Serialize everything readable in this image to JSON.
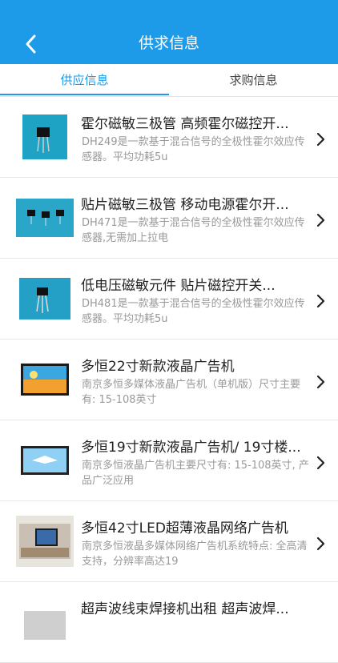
{
  "header": {
    "title": "供求信息",
    "back_icon": "back-arrow-icon"
  },
  "tabs": [
    {
      "label": "供应信息",
      "active": true
    },
    {
      "label": "求购信息",
      "active": false
    }
  ],
  "colors": {
    "primary": "#1e9be8",
    "title_text": "#222222",
    "desc_text": "#999999"
  },
  "items": [
    {
      "title": "霍尔磁敏三极管 高频霍尔磁控开...",
      "desc": "DH249是一款基于混合信号的全极性霍尔效应传感器。平均功耗5u",
      "thumb_icon": "hall-sensor-thumbnail"
    },
    {
      "title": "贴片磁敏三极管 移动电源霍尔开...",
      "desc": "DH471是一款基于混合信号的全极性霍尔效应传感器,无需加上拉电",
      "thumb_icon": "hall-sensor-thumbnail"
    },
    {
      "title": "低电压磁敏元件 贴片磁控开关...",
      "desc": "DH481是一款基于混合信号的全极性霍尔效应传感器。平均功耗5u",
      "thumb_icon": "hall-sensor-thumbnail"
    },
    {
      "title": "多恒22寸新款液晶广告机",
      "desc": "南京多恒多媒体液晶广告机（单机版）尺寸主要有: 15-108英寸",
      "thumb_icon": "lcd-display-thumbnail"
    },
    {
      "title": "多恒19寸新款液晶广告机/ 19寸楼...",
      "desc": "南京多恒液晶广告机主要尺寸有: 15-108英寸, 产品广泛应用",
      "thumb_icon": "lcd-display-thumbnail"
    },
    {
      "title": "多恒42寸LED超薄液晶网络广告机",
      "desc": "南京多恒液晶多媒体网络广告机系统特点: 全高清支持，分辨率高达19",
      "thumb_icon": "lcd-display-thumbnail"
    },
    {
      "title": "超声波线束焊接机出租 超声波焊...",
      "desc": "",
      "thumb_icon": "machine-thumbnail"
    }
  ]
}
